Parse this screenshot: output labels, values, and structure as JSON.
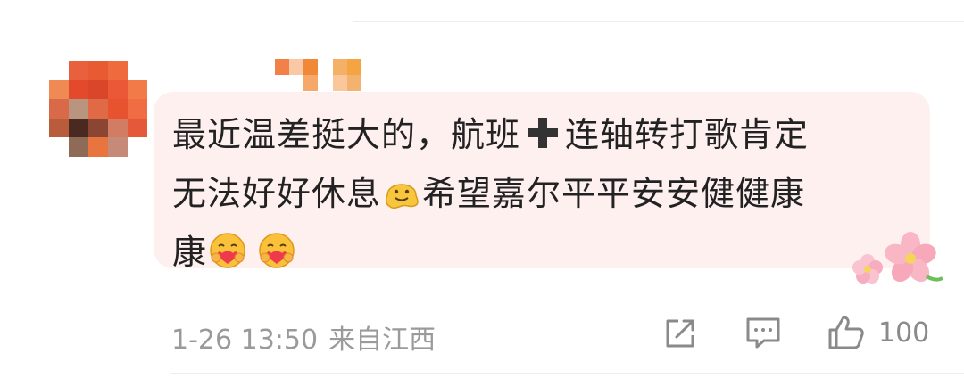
{
  "comment": {
    "text_line1_a": "最近温差挺大的，航班",
    "text_line1_b": "连轴转打歌肯定",
    "text_line2_a": "无法好好休息",
    "text_line2_b": "希望嘉尔平平安安健健康",
    "text_line3": "康",
    "inline_icons": [
      "heavy-plus-icon",
      "melting-face-emoji",
      "hug-face-emoji",
      "hug-face-emoji"
    ],
    "decoration": "cherry-blossom-icon"
  },
  "footer": {
    "date": "1-26 13:50",
    "location": "来自江西",
    "share_icon": "share-icon",
    "comment_icon": "comment-icon",
    "like_icon": "thumbs-up-icon",
    "like_count": "100"
  },
  "colors": {
    "bubble_bg": "#fdf0ee",
    "text": "#222222",
    "meta": "#9a9a9a"
  }
}
